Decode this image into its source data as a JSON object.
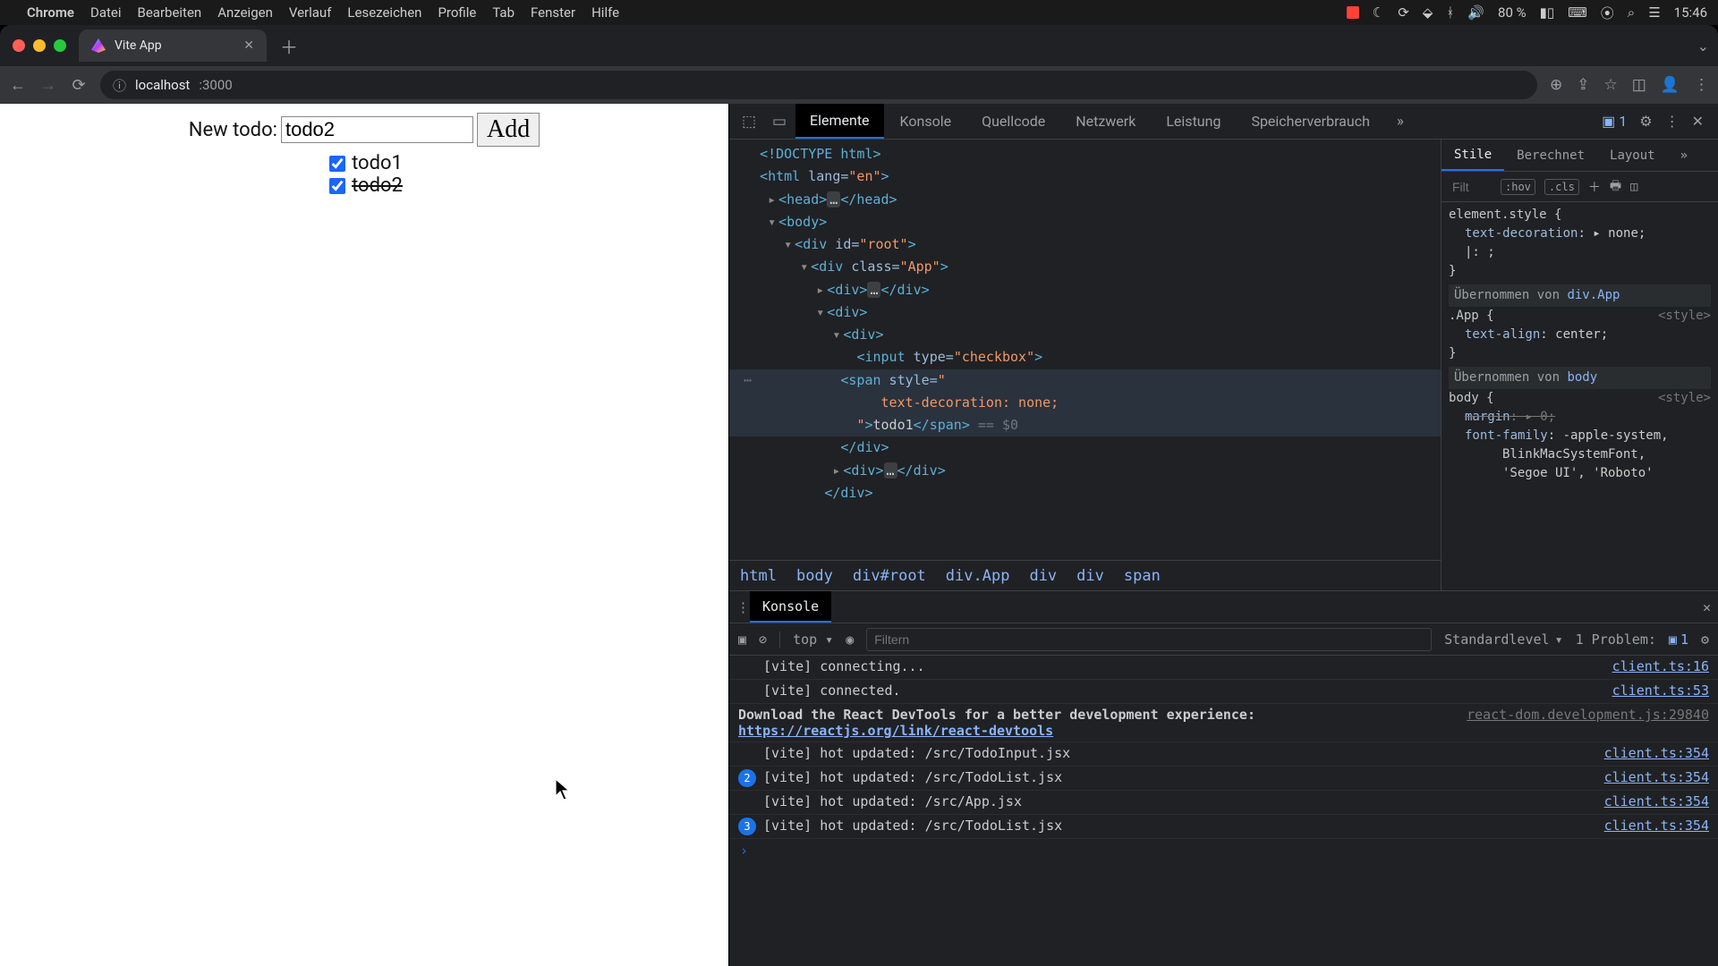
{
  "menubar": {
    "app": "Chrome",
    "items": [
      "Datei",
      "Bearbeiten",
      "Anzeigen",
      "Verlauf",
      "Lesezeichen",
      "Profile",
      "Tab",
      "Fenster",
      "Hilfe"
    ],
    "battery": "80 %",
    "time": "15:46"
  },
  "browser": {
    "tab_title": "Vite App",
    "url_host": "localhost",
    "url_port": ":3000"
  },
  "app": {
    "label": "New todo:",
    "input_value": "todo2",
    "add_button": "Add",
    "todos": [
      {
        "text": "todo1",
        "checked": true,
        "strike": false
      },
      {
        "text": "todo2",
        "checked": true,
        "strike": true
      }
    ]
  },
  "devtools": {
    "tabs": [
      "Elemente",
      "Konsole",
      "Quellcode",
      "Netzwerk",
      "Leistung",
      "Speicherverbrauch"
    ],
    "active_tab": "Elemente",
    "error_count": "1",
    "breadcrumbs": [
      "html",
      "body",
      "div#root",
      "div.App",
      "div",
      "div",
      "span"
    ],
    "styles": {
      "tabs": [
        "Stile",
        "Berechnet",
        "Layout"
      ],
      "active": "Stile",
      "filter_placeholder": "Filt",
      "hov": ":hov",
      "cls": ".cls",
      "rules": {
        "element_style_sel": "element.style {",
        "element_style_prop": "text-decoration",
        "element_style_val": "none;",
        "element_style_caret": "|: ;",
        "inherit1_label": "Übernommen von",
        "inherit1_cls": "div.App",
        "app_sel": ".App {",
        "app_src": "<style>",
        "app_prop": "text-align",
        "app_val": "center;",
        "inherit2_label": "Übernommen von",
        "inherit2_cls": "body",
        "body_sel": "body {",
        "body_src": "<style>",
        "body_margin_p": "margin",
        "body_margin_v": "0;",
        "body_ff_p": "font-family",
        "body_ff_v1": "-apple-system,",
        "body_ff_v2": "BlinkMacSystemFont,",
        "body_ff_v3": "'Segoe UI', 'Roboto'"
      }
    },
    "dom": {
      "l1": "<!DOCTYPE html>",
      "l2a": "<",
      "l2b": "html",
      "l2c": " lang=",
      "l2d": "\"en\"",
      "l2e": ">",
      "l3a": "<",
      "l3b": "head",
      "l3c": ">",
      "l3d": "…",
      "l3e": "</",
      "l3f": "head",
      "l3g": ">",
      "l4a": "<",
      "l4b": "body",
      "l4c": ">",
      "l5a": "<",
      "l5b": "div",
      "l5c": " id=",
      "l5d": "\"root\"",
      "l5e": ">",
      "l6a": "<",
      "l6b": "div",
      "l6c": " class=",
      "l6d": "\"App\"",
      "l6e": ">",
      "l7a": "<",
      "l7b": "div",
      "l7c": ">",
      "l7d": "…",
      "l7e": "</",
      "l7f": "div",
      "l7g": ">",
      "l8a": "<",
      "l8b": "div",
      "l8c": ">",
      "l9a": "<",
      "l9b": "div",
      "l9c": ">",
      "l10a": "<",
      "l10b": "input",
      "l10c": " type=",
      "l10d": "\"checkbox\"",
      "l10e": ">",
      "l11a": "<",
      "l11b": "span",
      "l11c": " style=",
      "l11d": "\"",
      "l12": "text-decoration: none;",
      "l13a": "\"",
      "l13b": ">",
      "l13c": "todo1",
      "l13d": "</",
      "l13e": "span",
      "l13f": ">",
      "l13g": " == $0",
      "l14a": "</",
      "l14b": "div",
      "l14c": ">",
      "l15a": "<",
      "l15b": "div",
      "l15c": ">",
      "l15d": "…",
      "l15e": "</",
      "l15f": "div",
      "l15g": ">",
      "l16a": "</",
      "l16b": "div",
      "l16c": ">"
    },
    "console": {
      "drawer_tab": "Konsole",
      "top": "top",
      "filter_placeholder": "Filtern",
      "level": "Standardlevel",
      "problems_label": "1 Problem:",
      "problems_count": "1",
      "logs": [
        {
          "count": "",
          "text": "[vite] connecting...",
          "src": "client.ts:16"
        },
        {
          "count": "",
          "text": "[vite] connected.",
          "src": "client.ts:53"
        },
        {
          "count": "",
          "dim_src_top": "react-dom.development.js:29840",
          "html": "Download the React DevTools for a better development experience: ",
          "link": "https://reactjs.org/link/react-devtools"
        },
        {
          "count": "",
          "text": "[vite] hot updated: /src/TodoInput.jsx",
          "src": "client.ts:354"
        },
        {
          "count": "2",
          "text": "[vite] hot updated: /src/TodoList.jsx",
          "src": "client.ts:354"
        },
        {
          "count": "",
          "text": "[vite] hot updated: /src/App.jsx",
          "src": "client.ts:354"
        },
        {
          "count": "3",
          "text": "[vite] hot updated: /src/TodoList.jsx",
          "src": "client.ts:354"
        }
      ]
    }
  }
}
